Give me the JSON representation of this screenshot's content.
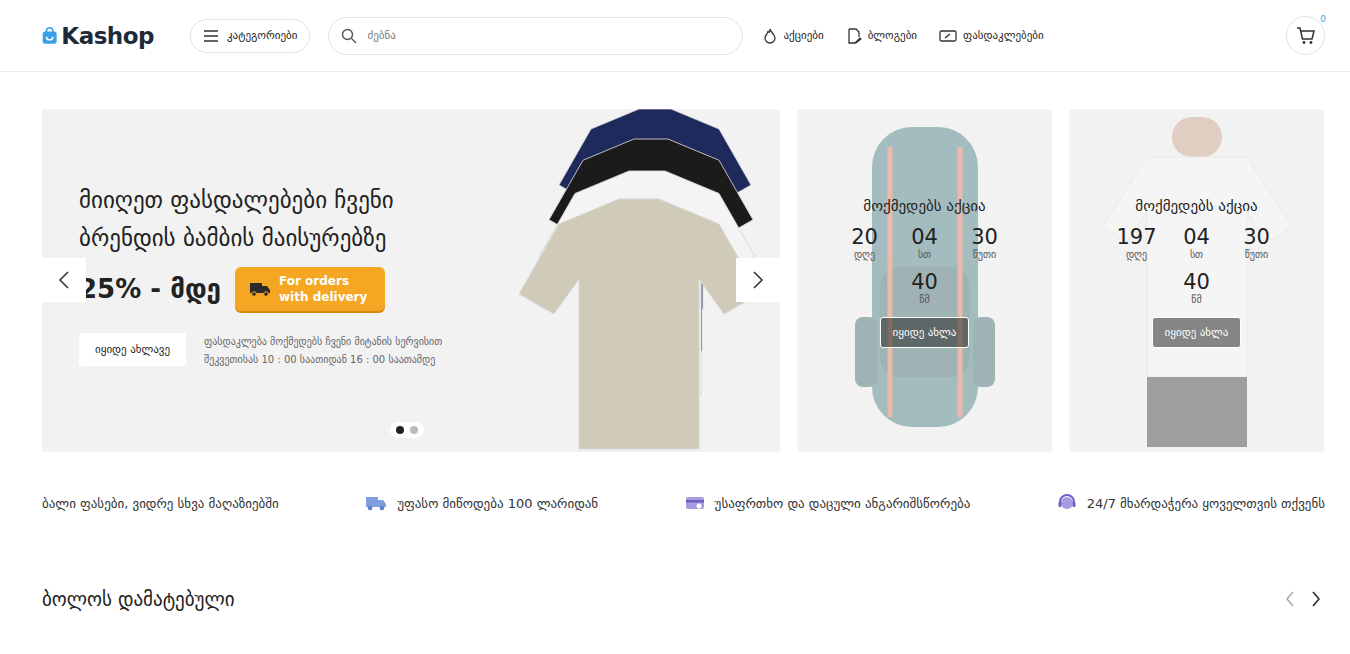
{
  "header": {
    "logo": "Kashop",
    "categories_button": "კატეგორიები",
    "search": {
      "placeholder": "ძებნა"
    },
    "nav": [
      {
        "label": "აქციები",
        "kind": "flame"
      },
      {
        "label": "ბლოგები",
        "kind": "blog"
      },
      {
        "label": "ფასდაკლებები",
        "kind": "ticket"
      }
    ],
    "cart": {
      "count": "0"
    }
  },
  "hero": {
    "title": "მიიღეთ ფასდალებები ჩვენი ბრენდის ბამბის მაისურებზე",
    "discount": "25% - მდე",
    "badge": "For orders with delivery",
    "button": "იყიდე ახლავე",
    "note": "ფასდაკლება მოქმედებს ჩვენი მიტანის სერვისით შეკვეთისას 10 : 00 საათიდან 16 : 00 საათამდე",
    "dots": [
      {
        "selected": true
      },
      {
        "selected": false
      }
    ]
  },
  "promos": [
    {
      "kind": "backpack",
      "title": "მოქმედებს აქცია",
      "countdown": [
        {
          "value": "20",
          "unit": "დღე"
        },
        {
          "value": "04",
          "unit": "სთ"
        },
        {
          "value": "30",
          "unit": "წუთი"
        },
        {
          "value": "40",
          "unit": "წმ"
        }
      ],
      "button": "იყიდე ახლა"
    },
    {
      "kind": "tshirt",
      "title": "მოქმედებს აქცია",
      "countdown": [
        {
          "value": "197",
          "unit": "დღე"
        },
        {
          "value": "04",
          "unit": "სთ"
        },
        {
          "value": "30",
          "unit": "წუთი"
        },
        {
          "value": "40",
          "unit": "წმ"
        }
      ],
      "button": "იყიდე ახლა"
    }
  ],
  "features": [
    {
      "kind": "price",
      "label": "ბალი ფასები, ვიდრე სხვა მაღაზიებში"
    },
    {
      "kind": "truck",
      "label": "უფასო მიწოდება 100 ლარიდან"
    },
    {
      "kind": "card",
      "label": "უსაფრთხო და დაცული ანგარიშსწორება"
    },
    {
      "kind": "support",
      "label": "24/7 მხარდაჭერა ყოველთვის თქვენს"
    }
  ],
  "section": {
    "title": "ბოლოს დამატებული"
  }
}
